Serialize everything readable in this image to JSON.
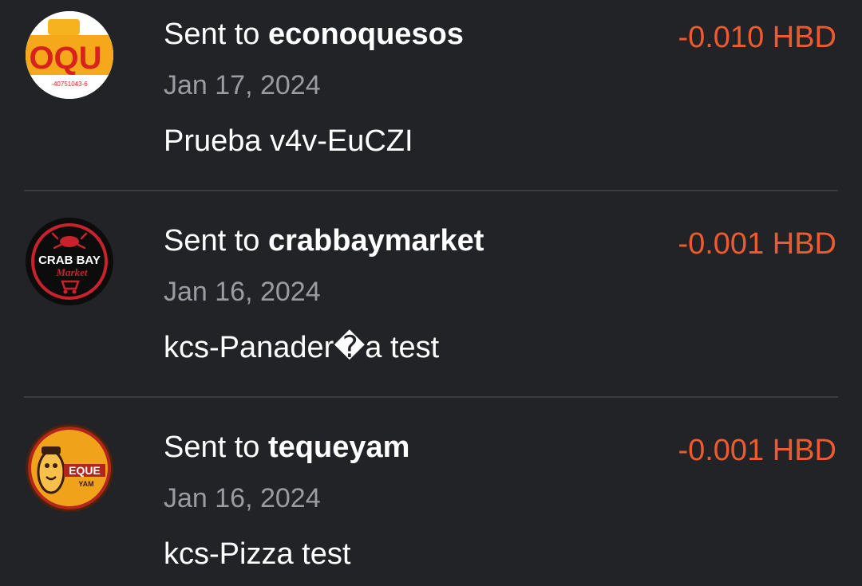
{
  "transactions": [
    {
      "prefix": "Sent to ",
      "recipient": "econoquesos",
      "amount": "-0.010 HBD",
      "date": "Jan 17, 2024",
      "memo": "Prueba v4v-EuCZI",
      "avatar": {
        "icon": "econoquesos-logo",
        "text": "OQU",
        "subtext": "-40751043-6"
      }
    },
    {
      "prefix": "Sent to ",
      "recipient": "crabbaymarket",
      "amount": "-0.001 HBD",
      "date": "Jan 16, 2024",
      "memo": "kcs-Panader�a test",
      "avatar": {
        "icon": "crab-bay-market-logo",
        "text": "CRAB BAY",
        "subtext": "Market"
      }
    },
    {
      "prefix": "Sent to ",
      "recipient": "tequeyam",
      "amount": "-0.001 HBD",
      "date": "Jan 16, 2024",
      "memo": "kcs-Pizza test",
      "avatar": {
        "icon": "teque-yam-logo",
        "text": "EQUE",
        "subtext": "YAM"
      }
    }
  ],
  "colors": {
    "background": "#212327",
    "amount": "#ee5b2f",
    "date": "#9a9ca1",
    "divider": "#3a3c41"
  }
}
